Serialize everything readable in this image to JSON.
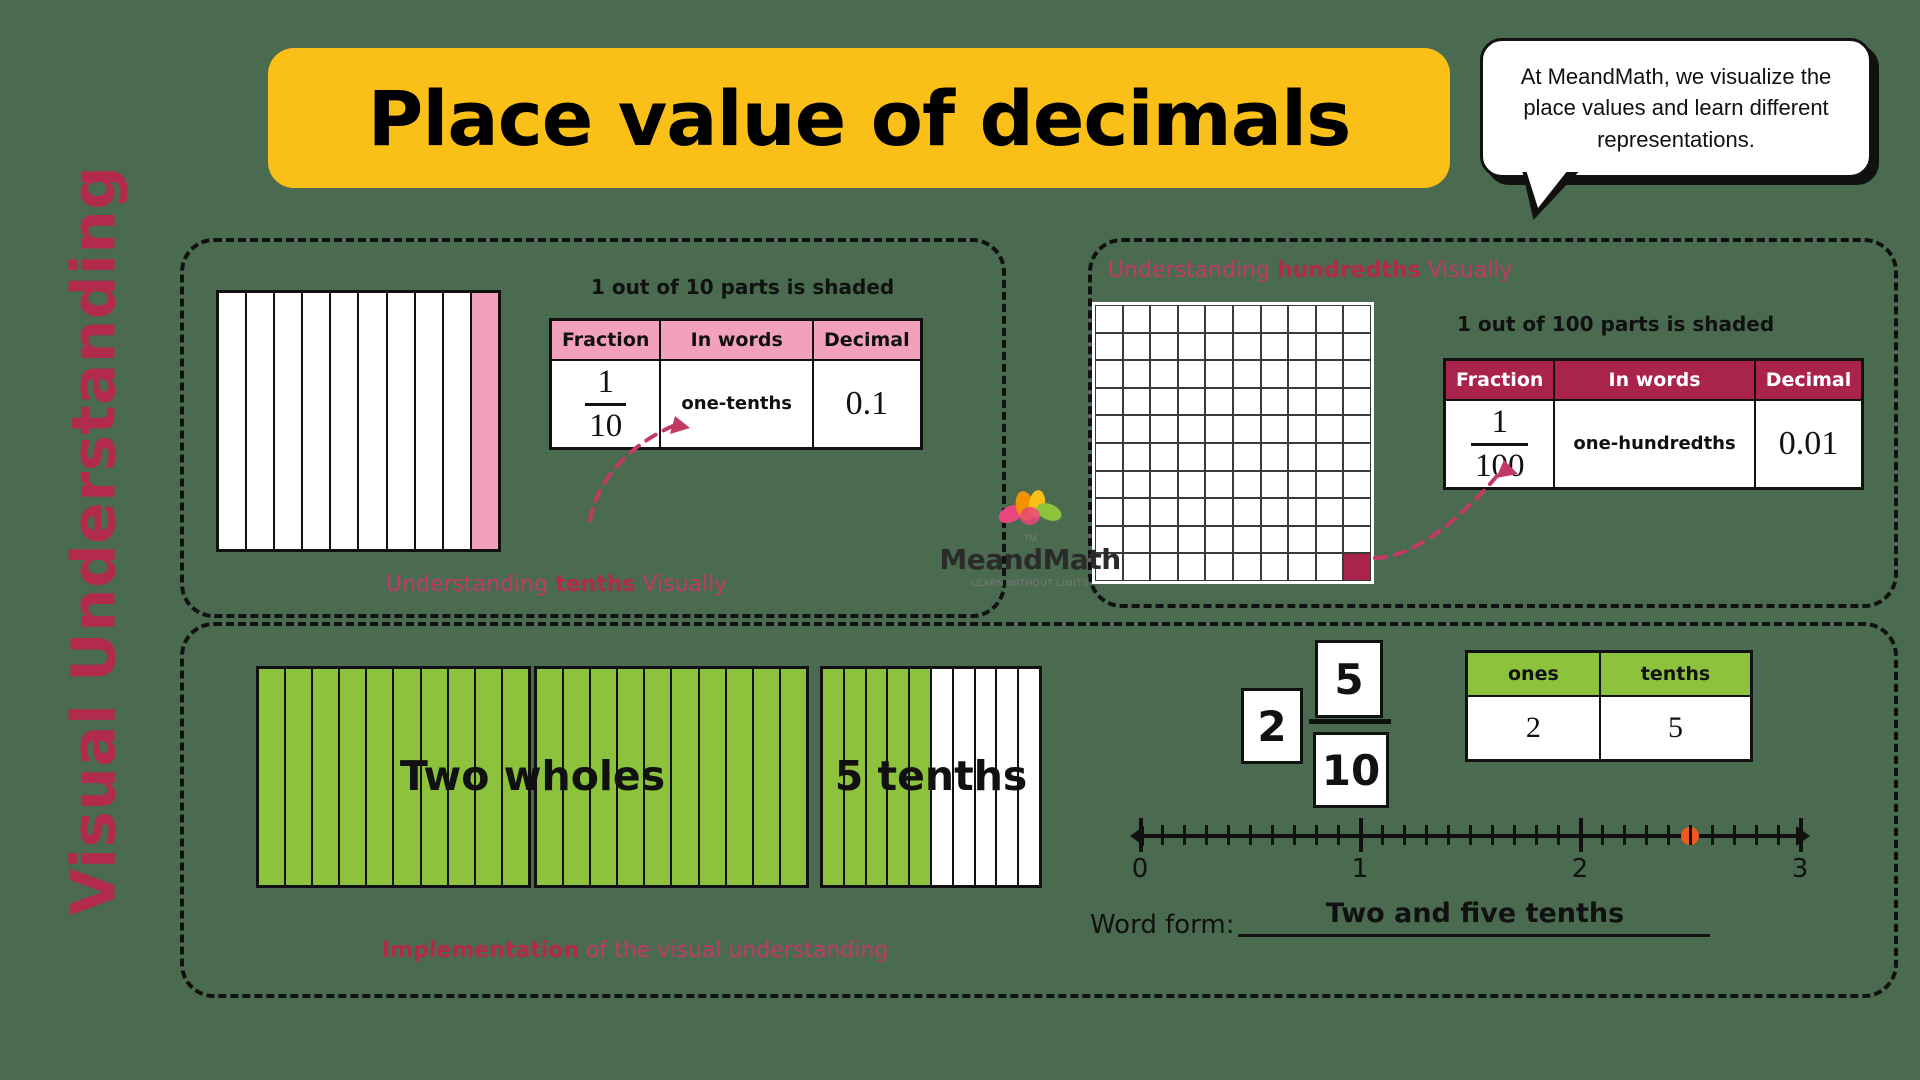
{
  "sidebar": {
    "vertical_title": "Visual Understanding"
  },
  "header": {
    "title": "Place value of decimals",
    "speech_bubble": "At MeandMath, we visualize the place values and learn different representations."
  },
  "brand": {
    "name": "MeandMath",
    "tagline": "LEARN WITHOUT LIMITS",
    "tm": "TM"
  },
  "tenths_panel": {
    "shaded_caption": "1 out of 10 parts is shaded",
    "caption_prefix": "Understanding ",
    "caption_bold": "tenths",
    "caption_suffix": " Visually",
    "bar_total_parts": 10,
    "bar_shaded_parts": 1,
    "table": {
      "headers": [
        "Fraction",
        "In words",
        "Decimal"
      ],
      "row": {
        "numerator": "1",
        "denominator": "10",
        "words": "one-tenths",
        "decimal": "0.1"
      }
    }
  },
  "hundredths_panel": {
    "shaded_caption": "1 out of 100 parts is shaded",
    "caption_prefix": "Understanding ",
    "caption_bold": "hundredths",
    "caption_suffix": " Visually",
    "grid_total_parts": 100,
    "grid_shaded_parts": 1,
    "table": {
      "headers": [
        "Fraction",
        "In words",
        "Decimal"
      ],
      "row": {
        "numerator": "1",
        "denominator": "100",
        "words": "one-hundredths",
        "decimal": "0.01"
      }
    }
  },
  "implementation_panel": {
    "caption_bold": "Implementation",
    "caption_rest": " of the visual understanding",
    "bars": [
      {
        "label": "",
        "total_parts": 10,
        "filled_parts": 10
      },
      {
        "label": "",
        "total_parts": 10,
        "filled_parts": 10
      },
      {
        "label": "",
        "total_parts": 10,
        "filled_parts": 5
      }
    ],
    "bar_label_wholes": "Two wholes",
    "bar_label_tenths": "5 tenths",
    "mixed_number": {
      "whole": "2",
      "numerator": "5",
      "denominator": "10"
    },
    "place_value_table": {
      "headers": [
        "ones",
        "tenths"
      ],
      "values": [
        "2",
        "5"
      ]
    },
    "number_line": {
      "labels": [
        "0",
        "1",
        "2",
        "3"
      ],
      "min": 0,
      "max": 3,
      "minor_per_unit": 10,
      "point_value": "2.5",
      "point_color": "#f05a22"
    },
    "word_form_label": "Word form:",
    "word_form_value": "Two and five tenths"
  },
  "colors": {
    "background": "#4a6b50",
    "banner": "#fbc017",
    "crimson": "#b22b4d",
    "deep_crimson": "#a9234c",
    "pink": "#f2a0bd",
    "green": "#8cc23c",
    "orange": "#f05a22"
  }
}
